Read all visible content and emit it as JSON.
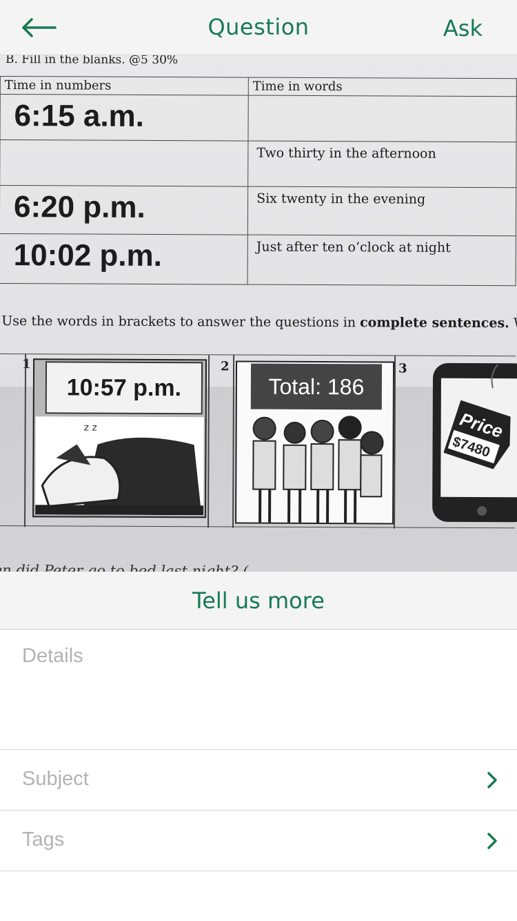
{
  "nav": {
    "title": "Question",
    "ask_label": "Ask",
    "back_icon": "arrow-left-icon"
  },
  "photo": {
    "section_heading": "B.   Fill in the blanks. @5 30%",
    "table": {
      "headers": [
        "Time in numbers",
        "Time in words"
      ],
      "rows": [
        {
          "numbers": "6:15 a.m.",
          "words": ""
        },
        {
          "numbers": "",
          "words": "Two thirty in the afternoon"
        },
        {
          "numbers": "6:20 p.m.",
          "words": "Six twenty in the evening"
        },
        {
          "numbers": "10:02 p.m.",
          "words": "Just after ten o’clock at night"
        }
      ]
    },
    "instruction_prefix": "Use the words in brackets to answer the questions in ",
    "instruction_bold": "complete sentences.",
    "instruction_suffix": " W",
    "pictures": [
      {
        "number": "1",
        "label": "10:57 p.m."
      },
      {
        "number": "2",
        "label": "Total: 186"
      },
      {
        "number": "3",
        "tag_line1": "Price",
        "tag_line2": "$7480"
      }
    ],
    "cut_line": "en did Peter go to bed last night? ("
  },
  "tell_more": "Tell us more",
  "form": {
    "details_placeholder": "Details",
    "subject_label": "Subject",
    "tags_label": "Tags"
  },
  "colors": {
    "accent": "#187a54",
    "background": "#f4f4f4",
    "placeholder": "#b3b3b3"
  }
}
